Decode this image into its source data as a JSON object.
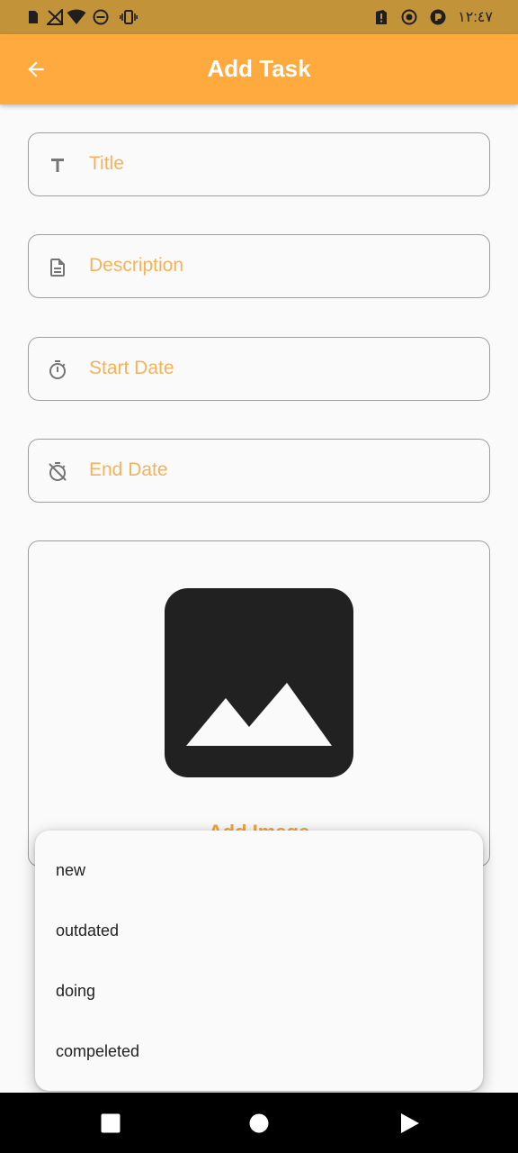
{
  "status_bar": {
    "time": "١٢:٤٧",
    "icons": [
      "sim-icon",
      "no-signal-icon",
      "wifi-icon",
      "do-not-disturb-icon",
      "vibrate-icon",
      "alert-icon",
      "record-icon",
      "app-icon"
    ]
  },
  "app_bar": {
    "title": "Add Task",
    "back_icon": "arrow-back-icon",
    "color": "#ffaa3f"
  },
  "fields": [
    {
      "icon": "title-icon",
      "placeholder": "Title"
    },
    {
      "icon": "description-icon",
      "placeholder": "Description"
    },
    {
      "icon": "timer-icon",
      "placeholder": "Start Date"
    },
    {
      "icon": "timer-off-icon",
      "placeholder": "End Date"
    }
  ],
  "image_card": {
    "icon": "image-icon",
    "label": "Add Image"
  },
  "menu": {
    "items": [
      "new",
      "outdated",
      "doing",
      "compeleted"
    ]
  },
  "nav_bar": {
    "buttons": [
      "recents-button",
      "home-button",
      "back-button"
    ]
  },
  "colors": {
    "accent": "#ffaa3f",
    "placeholder": "#f4b35a",
    "status_bar": "#c3933a"
  }
}
